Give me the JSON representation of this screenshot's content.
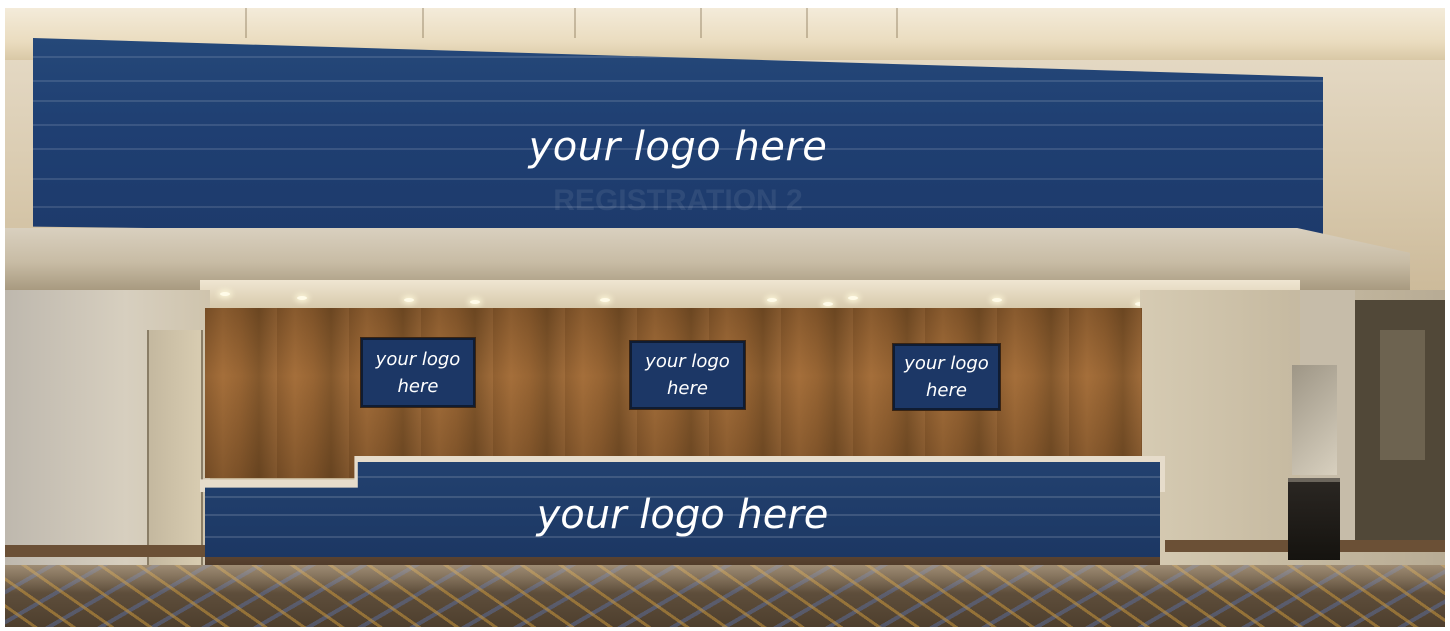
{
  "banner": {
    "logo_text": "your logo here",
    "ghost_sign": "REGISTRATION 2"
  },
  "screens": [
    {
      "line1": "your logo",
      "line2": "here"
    },
    {
      "line1": "your logo",
      "line2": "here"
    },
    {
      "line1": "your logo",
      "line2": "here"
    }
  ],
  "desk": {
    "logo_text": "your logo here"
  },
  "colors": {
    "brand_blue": "#1f3c69",
    "wood": "#8c5c2e",
    "logo_text": "#ffffff"
  }
}
